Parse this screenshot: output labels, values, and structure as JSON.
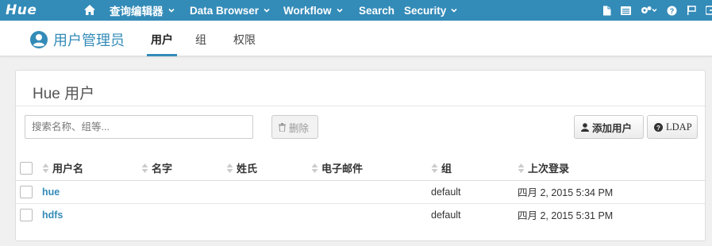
{
  "nav": {
    "logo": "Hue",
    "items": [
      {
        "label": "查询编辑器",
        "dropdown": true
      },
      {
        "label": "Data Browser",
        "dropdown": true
      },
      {
        "label": "Workflow",
        "dropdown": true
      },
      {
        "label": "Search",
        "dropdown": false
      },
      {
        "label": "Security",
        "dropdown": true
      }
    ],
    "right_icons": [
      "file-icon",
      "list-icon",
      "cogs-icon",
      "help-icon",
      "flag-icon",
      "signout-icon"
    ]
  },
  "subheader": {
    "app_title": "用户管理员",
    "tabs": [
      {
        "label": "用户",
        "active": true
      },
      {
        "label": "组",
        "active": false
      },
      {
        "label": "权限",
        "active": false
      }
    ]
  },
  "card": {
    "title": "Hue 用户",
    "search_placeholder": "搜索名称、组等...",
    "delete_label": "删除",
    "add_user_label": "添加用户",
    "ldap_label": "LDAP"
  },
  "table": {
    "columns": [
      "用户名",
      "名字",
      "姓氏",
      "电子邮件",
      "组",
      "上次登录"
    ],
    "rows": [
      {
        "username": "hue",
        "first_name": "",
        "last_name": "",
        "email": "",
        "group": "default",
        "last_login": "四月 2, 2015 5:34 PM"
      },
      {
        "username": "hdfs",
        "first_name": "",
        "last_name": "",
        "email": "",
        "group": "default",
        "last_login": "四月 2, 2015 5:31 PM"
      }
    ]
  },
  "colors": {
    "brand": "#338bb8",
    "background": "#f0f0f0"
  }
}
